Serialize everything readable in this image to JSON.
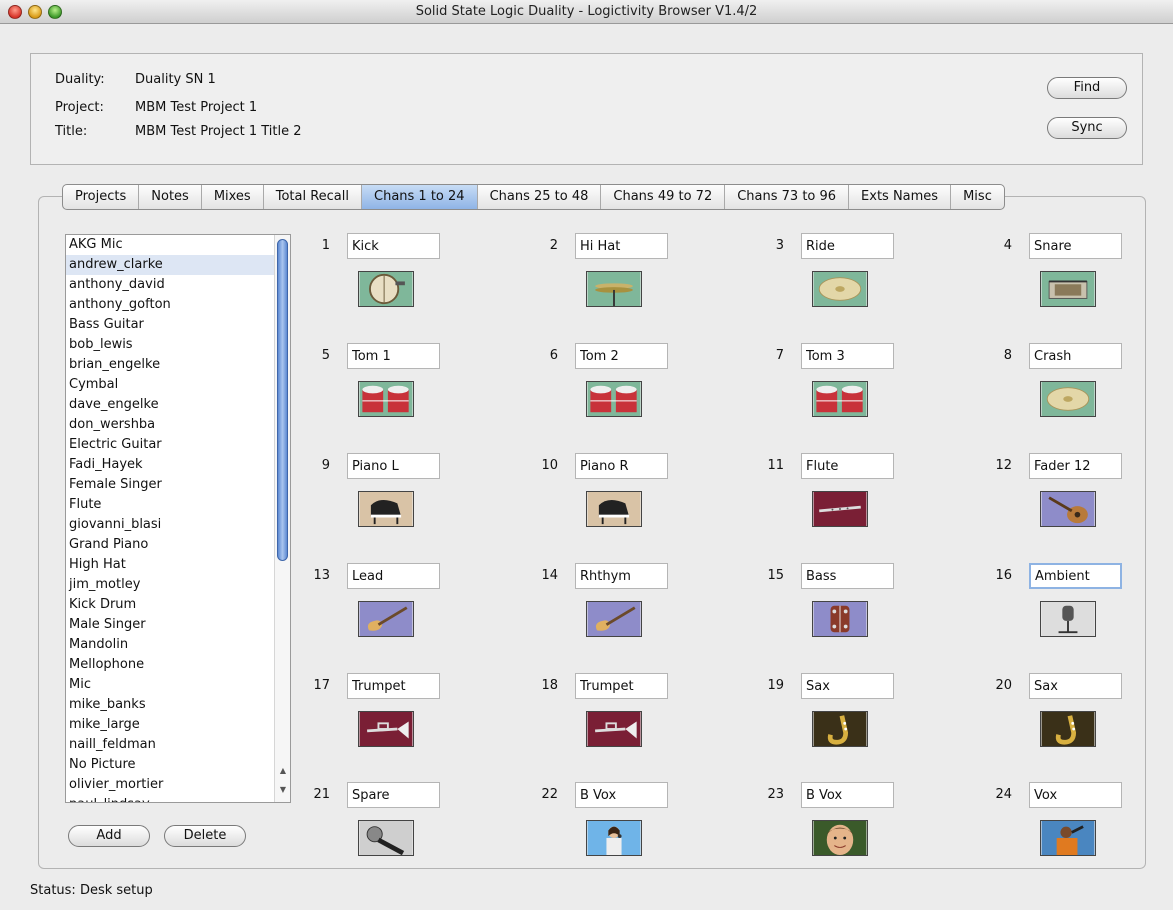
{
  "window": {
    "title": "Solid State Logic Duality - Logictivity Browser V1.4/2"
  },
  "info": {
    "duality_label": "Duality:",
    "duality_value": "Duality SN 1",
    "project_label": "Project:",
    "project_value": "MBM Test Project 1",
    "title_label": "Title:",
    "title_value": "MBM Test Project 1 Title 2",
    "find_label": "Find",
    "sync_label": "Sync"
  },
  "tabs": [
    "Projects",
    "Notes",
    "Mixes",
    "Total Recall",
    "Chans 1 to 24",
    "Chans 25 to 48",
    "Chans 49 to 72",
    "Chans 73 to 96",
    "Exts Names",
    "Misc"
  ],
  "active_tab": "Chans 1 to 24",
  "names_list": {
    "items": [
      "AKG Mic",
      "andrew_clarke",
      "anthony_david",
      "anthony_gofton",
      "Bass Guitar",
      "bob_lewis",
      "brian_engelke",
      "Cymbal",
      "dave_engelke",
      "don_wershba",
      "Electric Guitar",
      "Fadi_Hayek",
      "Female Singer",
      "Flute",
      "giovanni_blasi",
      "Grand Piano",
      "High Hat",
      "jim_motley",
      "Kick Drum",
      "Male Singer",
      "Mandolin",
      "Mellophone",
      "Mic",
      "mike_banks",
      "mike_large",
      "naill_feldman",
      "No Picture",
      "olivier_mortier",
      "paul_lindsay"
    ],
    "selected": "andrew_clarke",
    "add_label": "Add",
    "delete_label": "Delete"
  },
  "channels": [
    {
      "num": "1",
      "name": "Kick",
      "icon": "kick-drum-icon",
      "bg": "#7fb79a"
    },
    {
      "num": "2",
      "name": "Hi Hat",
      "icon": "hi-hat-icon",
      "bg": "#7fb79a"
    },
    {
      "num": "3",
      "name": "Ride",
      "icon": "cymbal-icon",
      "bg": "#7fb79a"
    },
    {
      "num": "4",
      "name": "Snare",
      "icon": "snare-drum-icon",
      "bg": "#7fb79a"
    },
    {
      "num": "5",
      "name": "Tom 1",
      "icon": "tom-drum-icon",
      "bg": "#7fb79a"
    },
    {
      "num": "6",
      "name": "Tom 2",
      "icon": "tom-drum-icon",
      "bg": "#7fb79a"
    },
    {
      "num": "7",
      "name": "Tom 3",
      "icon": "tom-drum-icon",
      "bg": "#7fb79a"
    },
    {
      "num": "8",
      "name": "Crash",
      "icon": "cymbal-icon",
      "bg": "#7fb79a"
    },
    {
      "num": "9",
      "name": "Piano L",
      "icon": "grand-piano-icon",
      "bg": "#d9c3a6"
    },
    {
      "num": "10",
      "name": "Piano R",
      "icon": "grand-piano-icon",
      "bg": "#d9c3a6"
    },
    {
      "num": "11",
      "name": "Flute",
      "icon": "flute-icon",
      "bg": "#7a1f35"
    },
    {
      "num": "12",
      "name": "Fader 12",
      "icon": "mandolin-icon",
      "bg": "#8e8cc9"
    },
    {
      "num": "13",
      "name": "Lead",
      "icon": "electric-guitar-icon",
      "bg": "#8e8cc9"
    },
    {
      "num": "14",
      "name": "Rhthym",
      "icon": "electric-guitar-icon",
      "bg": "#8e8cc9"
    },
    {
      "num": "15",
      "name": "Bass",
      "icon": "bass-guitar-icon",
      "bg": "#8e8cc9"
    },
    {
      "num": "16",
      "name": "Ambient",
      "icon": "ambient-mic-icon",
      "bg": "#dddddd"
    },
    {
      "num": "17",
      "name": "Trumpet",
      "icon": "trumpet-icon",
      "bg": "#7a1f35"
    },
    {
      "num": "18",
      "name": "Trumpet",
      "icon": "trumpet-icon",
      "bg": "#7a1f35"
    },
    {
      "num": "19",
      "name": "Sax",
      "icon": "saxophone-icon",
      "bg": "#3a3018"
    },
    {
      "num": "20",
      "name": "Sax",
      "icon": "saxophone-icon",
      "bg": "#3a3018"
    },
    {
      "num": "21",
      "name": "Spare",
      "icon": "microphone-icon",
      "bg": "#cfcfcf"
    },
    {
      "num": "22",
      "name": "B Vox",
      "icon": "female-singer-icon",
      "bg": "#6fb4e8"
    },
    {
      "num": "23",
      "name": "B Vox",
      "icon": "face-photo-icon",
      "bg": "#3a5a2a"
    },
    {
      "num": "24",
      "name": "Vox",
      "icon": "male-singer-icon",
      "bg": "#4a86c0"
    }
  ],
  "focused_channel": "16",
  "status": {
    "label": "Status:",
    "value": "Desk setup"
  }
}
